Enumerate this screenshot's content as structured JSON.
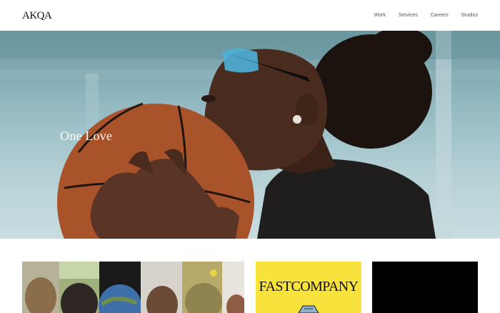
{
  "header": {
    "logo": "AKQA",
    "nav": [
      {
        "label": "Work"
      },
      {
        "label": "Services"
      },
      {
        "label": "Careers"
      },
      {
        "label": "Studios"
      }
    ]
  },
  "hero": {
    "title": "One Love",
    "image": "basketball-player-with-sunglasses"
  },
  "cards": [
    {
      "image": "portrait-collage"
    },
    {
      "logo": "FASTCOMPANY",
      "background": "#f7e33c"
    },
    {
      "image": "black-tile",
      "background": "#000000"
    }
  ]
}
